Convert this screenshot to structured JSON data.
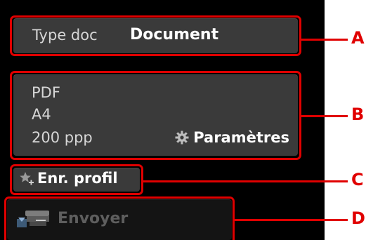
{
  "doc_type": {
    "label": "Type doc",
    "value": "Document"
  },
  "scan_settings": {
    "format": "PDF",
    "paper_size": "A4",
    "resolution": "200 ppp",
    "settings_button_label": "Paramètres",
    "settings_icon": "gear-icon"
  },
  "profile": {
    "label": "Enr. profil",
    "icon": "star-icon"
  },
  "send": {
    "label": "Envoyer",
    "icon": "scan-icon",
    "state": "disabled"
  },
  "callouts": {
    "a": "A",
    "b": "B",
    "c": "C",
    "d": "D"
  },
  "colors": {
    "callout": "#e00000",
    "screen_bg": "#000000",
    "panel_bg": "#3a3a3a"
  }
}
